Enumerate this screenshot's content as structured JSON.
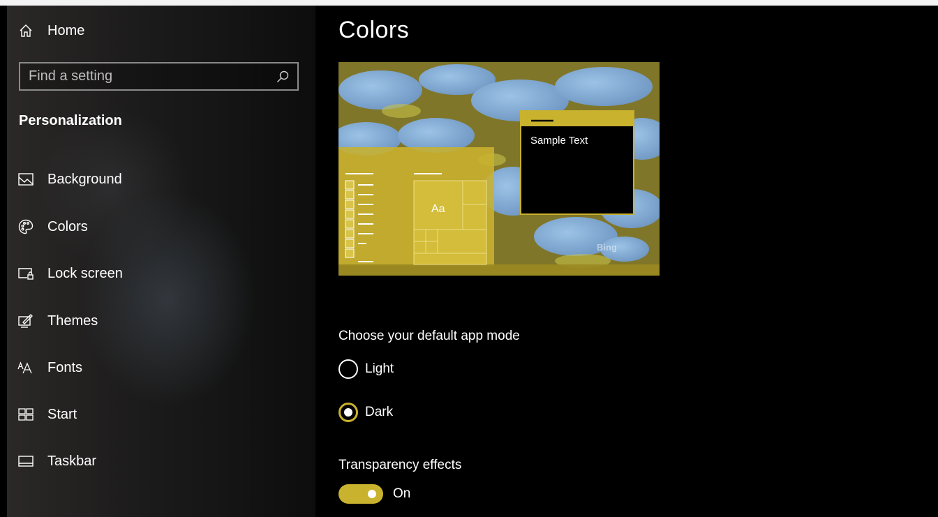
{
  "sidebar": {
    "home_label": "Home",
    "search_placeholder": "Find a setting",
    "section_title": "Personalization",
    "items": [
      {
        "label": "Background",
        "icon": "picture-icon"
      },
      {
        "label": "Colors",
        "icon": "palette-icon"
      },
      {
        "label": "Lock screen",
        "icon": "lock-screen-icon"
      },
      {
        "label": "Themes",
        "icon": "themes-icon"
      },
      {
        "label": "Fonts",
        "icon": "fonts-icon"
      },
      {
        "label": "Start",
        "icon": "start-icon"
      },
      {
        "label": "Taskbar",
        "icon": "taskbar-icon"
      }
    ]
  },
  "main": {
    "title": "Colors",
    "preview": {
      "sample_text": "Sample Text",
      "tile_text": "Aa",
      "watermark": "Bing"
    },
    "app_mode": {
      "heading": "Choose your default app mode",
      "options": [
        {
          "label": "Light",
          "selected": false
        },
        {
          "label": "Dark",
          "selected": true
        }
      ]
    },
    "transparency": {
      "heading": "Transparency effects",
      "state_label": "On",
      "enabled": true
    }
  },
  "colors": {
    "accent": "#c9b22e",
    "background": "#000000",
    "sidebar_bg": "#1d1c1c"
  }
}
